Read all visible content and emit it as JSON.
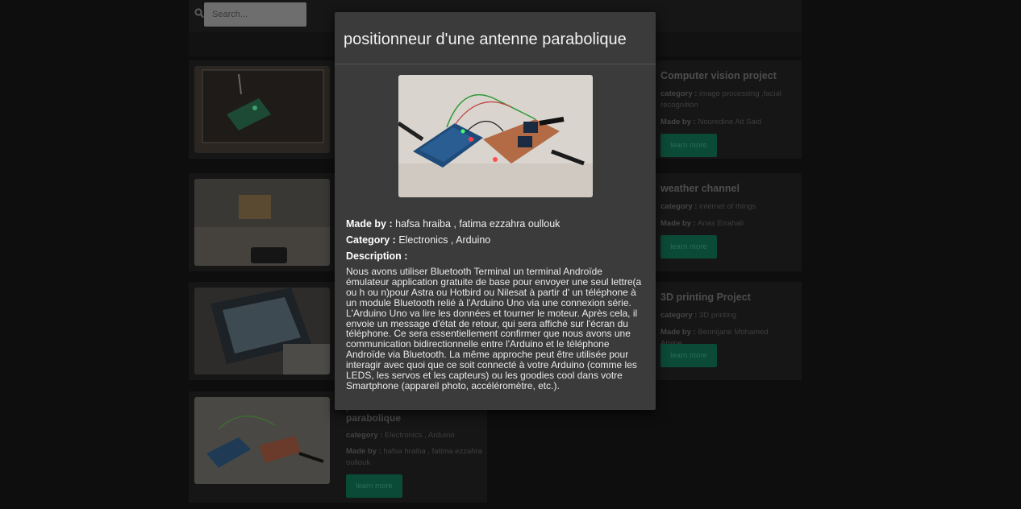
{
  "search": {
    "placeholder": "Search..."
  },
  "labels": {
    "category": "category :",
    "made_by": "Made by :",
    "learn_more": "learn more"
  },
  "left_cards": [
    {
      "title": "",
      "category": "",
      "made_by": ""
    },
    {
      "title": "",
      "category": "",
      "made_by": ""
    },
    {
      "title": "",
      "category": "",
      "made_by": ""
    },
    {
      "title": "positionneur d'une antenne parabolique",
      "category": "Electronics , Arduino",
      "made_by": "hafsa hraiba , fatima ezzahra oullouk"
    }
  ],
  "right_cards": [
    {
      "title": "Computer vision project",
      "category": "image processing ,facial recognition",
      "made_by": "Nouredine Ait Said"
    },
    {
      "title": "weather channel",
      "category": "internet of things",
      "made_by": "Anas Errahali"
    },
    {
      "title": "3D printing Project",
      "category": "3D printing",
      "made_by": "Bennijane Mohamed Amine"
    }
  ],
  "modal": {
    "title": "positionneur d'une antenne parabolique",
    "made_by_label": "Made by :",
    "made_by": "hafsa hraiba , fatima ezzahra oullouk",
    "category_label": "Category :",
    "category": "Electronics , Arduino",
    "description_label": "Description :",
    "description": "Nous avons utiliser Bluetooth Terminal un terminal Androïde émulateur application gratuite de base pour envoyer une seul lettre(a ou h ou n)pour Astra ou Hotbird ou Nilesat à partir d' un téléphone à un module Bluetooth relié à l'Arduino Uno via une connexion série. L'Arduino Uno va lire les données et tourner le moteur. Après cela, il envoie un message d'état de retour, qui sera affiché sur l'écran du téléphone. Ce sera essentiellement confirmer que nous avons une communication bidirectionnelle entre l'Arduino et le téléphone Androïde via Bluetooth. La même approche peut être utilisée pour interagir avec quoi que ce soit connecté à votre Arduino (comme les LEDS, les servos et les capteurs) ou les goodies cool dans votre Smartphone (appareil photo, accéléromètre, etc.)."
  },
  "colors": {
    "accent": "#0a4a36",
    "modal_bg": "#3b3b3b",
    "page_bg": "#0e0e0e"
  }
}
